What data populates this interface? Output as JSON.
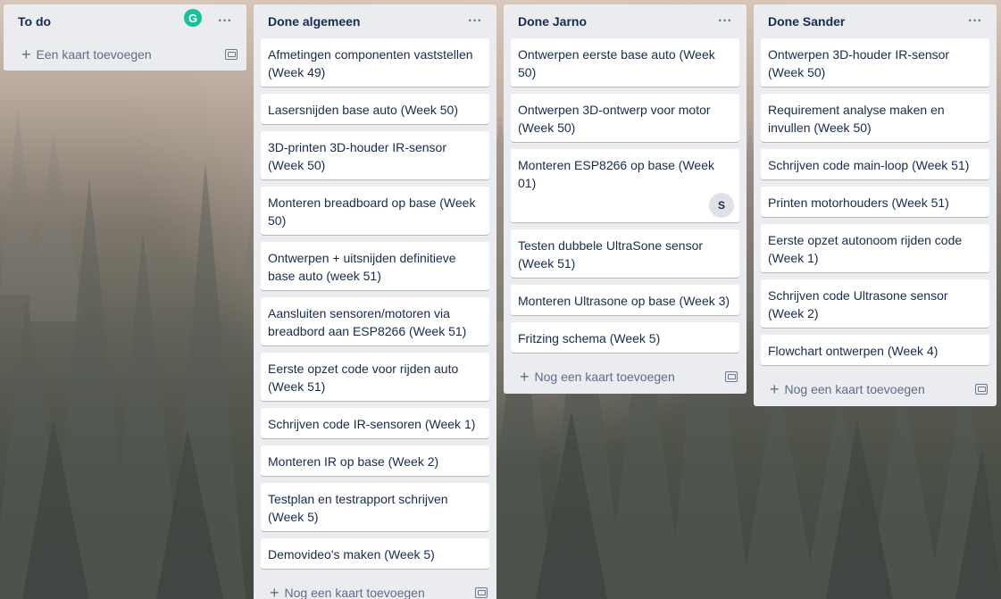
{
  "lists": [
    {
      "title": "To do",
      "cards": [],
      "add_label": "Een kaart toevoegen"
    },
    {
      "title": "Done algemeen",
      "cards": [
        "Afmetingen componenten vaststellen (Week 49)",
        "Lasersnijden base auto (Week 50)",
        "3D-printen 3D-houder IR-sensor (Week 50)",
        "Monteren breadboard op base (Week 50)",
        "Ontwerpen + uitsnijden definitieve base auto (week 51)",
        "Aansluiten sensoren/motoren via breadbord aan ESP8266 (Week 51)",
        "Eerste opzet code voor rijden auto (Week 51)",
        "Schrijven code IR-sensoren (Week 1)",
        "Monteren IR op base (Week 2)",
        "Testplan en testrapport schrijven (Week 5)",
        "Demovideo's maken (Week 5)"
      ],
      "add_label": "Nog een kaart toevoegen"
    },
    {
      "title": "Done Jarno",
      "cards": [
        "Ontwerpen eerste base auto (Week 50)",
        "Ontwerpen 3D-ontwerp voor motor (Week 50)",
        "Monteren ESP8266 op base (Week 01)",
        "Testen dubbele UltraSone sensor (Week 51)",
        "Monteren Ultrasone op base (Week 3)",
        "Fritzing schema (Week 5)"
      ],
      "member_initial": "S",
      "add_label": "Nog een kaart toevoegen"
    },
    {
      "title": "Done Sander",
      "cards": [
        "Ontwerpen 3D-houder IR-sensor (Week 50)",
        "Requirement analyse maken en invullen (Week 50)",
        "Schrijven code main-loop (Week 51)",
        "Printen motorhouders (Week 51)",
        "Eerste opzet autonoom rijden code (Week 1)",
        "Schrijven code Ultrasone sensor (Week 2)",
        "Flowchart ontwerpen (Week 4)"
      ],
      "add_label": "Nog een kaart toevoegen"
    }
  ],
  "menu_glyph": "···",
  "plus_glyph": "+",
  "grammarly_glyph": "G",
  "icons": {
    "menu": "more-horizontal-icon",
    "add": "plus-icon",
    "template": "card-template-icon",
    "grammarly": "grammarly-icon"
  }
}
